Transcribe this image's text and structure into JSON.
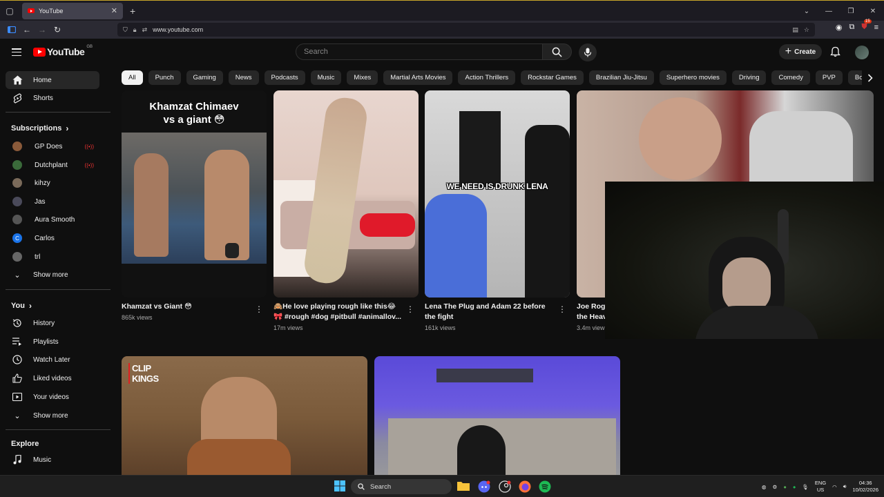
{
  "browser": {
    "tab_title": "YouTube",
    "url": "www.youtube.com",
    "extension_badge": "15"
  },
  "header": {
    "logo_text": "YouTube",
    "region": "GB",
    "search_placeholder": "Search",
    "create_label": "Create"
  },
  "sidebar": {
    "main": [
      {
        "label": "Home",
        "icon": "home-icon"
      },
      {
        "label": "Shorts",
        "icon": "shorts-icon"
      }
    ],
    "subscriptions_heading": "Subscriptions",
    "subscriptions": [
      {
        "label": "GP Does",
        "color": "#8a5a3a",
        "live": true
      },
      {
        "label": "Dutchplant",
        "color": "#3a6a3a",
        "live": true
      },
      {
        "label": "kihzy",
        "color": "#7a6a5a",
        "live": false
      },
      {
        "label": "Jas",
        "color": "#4a4a5a",
        "live": false
      },
      {
        "label": "Aura Smooth",
        "color": "#555555",
        "live": false
      },
      {
        "label": "Carlos",
        "color": "#1a73e8",
        "letter": "C",
        "live": false
      },
      {
        "label": "trl",
        "color": "#666666",
        "live": false
      }
    ],
    "show_more_1": "Show more",
    "you_heading": "You",
    "you": [
      {
        "label": "History",
        "icon": "history-icon"
      },
      {
        "label": "Playlists",
        "icon": "playlists-icon"
      },
      {
        "label": "Watch Later",
        "icon": "watch-later-icon"
      },
      {
        "label": "Liked videos",
        "icon": "thumbs-up-icon"
      },
      {
        "label": "Your videos",
        "icon": "your-videos-icon"
      }
    ],
    "show_more_2": "Show more",
    "explore_heading": "Explore",
    "explore": [
      {
        "label": "Music",
        "icon": "music-icon"
      }
    ]
  },
  "chips": [
    "All",
    "Punch",
    "Gaming",
    "News",
    "Podcasts",
    "Music",
    "Mixes",
    "Martial Arts Movies",
    "Action Thrillers",
    "Rockstar Games",
    "Brazilian Jiu-Jitsu",
    "Superhero movies",
    "Driving",
    "Comedy",
    "PVP",
    "Body-Building"
  ],
  "videos": [
    {
      "title": "Khamzat vs Giant 😳",
      "title_line2": "",
      "views": "865k views",
      "overlay_1": "Khamzat Chimaev",
      "overlay_2": "vs a giant 😳"
    },
    {
      "title": "🙈He love playing rough like this😂",
      "title_line2": "🎀 #rough #dog #pitbull #animallov...",
      "views": "17m views"
    },
    {
      "title": "Lena The Plug and Adam 22 before",
      "title_line2": "the fight",
      "views": "161k views",
      "overlay_1": "WE NEED IS DRUNK LENA"
    },
    {
      "title": "Joe Rog",
      "title_line2": "the Heav",
      "views": "3.4m view"
    }
  ],
  "row2": {
    "clip_kings_1": "CLIP",
    "clip_kings_2": "KINGS"
  },
  "taskbar": {
    "search_label": "Search",
    "lang_1": "ENG",
    "lang_2": "US",
    "time": "04:36",
    "date": "10/02/2026"
  },
  "colors": {
    "background": "#0f0f0f",
    "accent_red": "#ff0000",
    "chip_bg": "#272727"
  }
}
